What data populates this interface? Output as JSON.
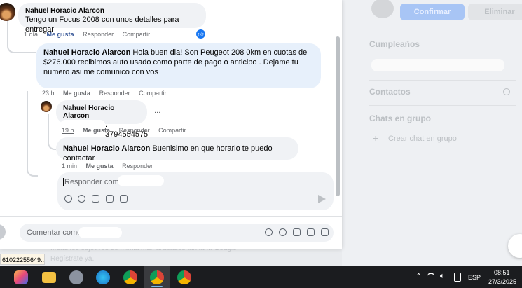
{
  "comments": [
    {
      "author": "Nahuel Horacio Alarcon",
      "text": "Tengo un Focus 2008 con unos detalles para entregar",
      "time": "1 día",
      "like": "Me gusta",
      "reply": "Responder",
      "share": "Compartir"
    },
    {
      "author": "Nahuel Horacio Alarcon",
      "text": "Hola buen dia! Son Peugeot 208 0km en cuotas de $276.000 recibimos auto usado como parte de pago o anticipo . Dejame tu numero asi me comunico con vos",
      "time": "23 h",
      "like": "Me gusta",
      "reply": "Responder",
      "share": "Compartir"
    },
    {
      "author": "Nahuel Horacio Alarcon",
      "text": ". 3794554575",
      "more": "...",
      "time": "19 h",
      "like": "Me gusta",
      "reply": "Responder",
      "share": "Compartir"
    },
    {
      "author": "Nahuel Horacio Alarcon",
      "text": "Buenisimo en que horario te puedo contactar",
      "time": "1 min",
      "like": "Me gusta",
      "reply": "Responder"
    }
  ],
  "reply_box": {
    "placeholder": "Responder como"
  },
  "comment_box": {
    "placeholder": "Comentar como"
  },
  "right_panel": {
    "confirm": "Confirmar",
    "delete": "Eliminar",
    "birthdays": "Cumpleaños",
    "contacts": "Contactos",
    "group_chats": "Chats en grupo",
    "create_group": "Crear chat en grupo"
  },
  "background": {
    "line1": "...dad los objetivos de mimia mal, arabades tan la ... Goagle",
    "line2": "Regístrate ya."
  },
  "tooltip": "61022255649...",
  "tray": {
    "lang": "ESP",
    "time": "08:51",
    "date": "27/3/2025"
  },
  "colors": {
    "facebook_blue": "#0866ff",
    "link": "#385898"
  }
}
